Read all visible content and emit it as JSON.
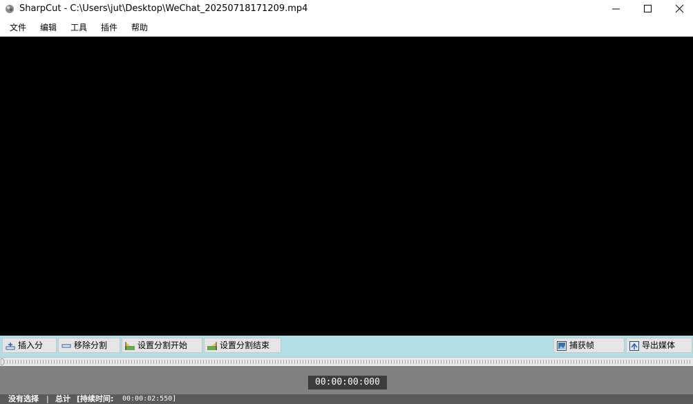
{
  "window": {
    "title": "SharpCut - C:\\Users\\jut\\Desktop\\WeChat_20250718171209.mp4",
    "icon": "sharpcut-app-icon",
    "controls": [
      "minimize-icon",
      "maximize-icon",
      "close-icon"
    ]
  },
  "menu": {
    "items": [
      {
        "label": "文件"
      },
      {
        "label": "编辑"
      },
      {
        "label": "工具"
      },
      {
        "label": "插件"
      },
      {
        "label": "帮助"
      }
    ]
  },
  "toolbar": {
    "insert_split": {
      "label": "插入分",
      "icon": "insert-split-icon"
    },
    "remove_split": {
      "label": "移除分割",
      "icon": "remove-split-icon"
    },
    "set_split_start": {
      "label": "设置分割开始",
      "icon": "split-start-icon"
    },
    "set_split_end": {
      "label": "设置分割结束",
      "icon": "split-end-icon"
    },
    "capture_frame": {
      "label": "捕获帧",
      "icon": "capture-frame-icon"
    },
    "export_media": {
      "label": "导出媒体",
      "icon": "export-media-icon"
    }
  },
  "player": {
    "timecode": "00:00:00:000"
  },
  "status": {
    "selection": "没有选择",
    "separator": "|",
    "total_label": "总计",
    "duration_label": "[持续时间:",
    "duration_value": "00:00:02:550]"
  },
  "colors": {
    "video_bg": "#000000",
    "toolbar_bg": "#b0e0e6",
    "panel_bg": "#808080",
    "timecode_bg": "#3c3c3c"
  }
}
